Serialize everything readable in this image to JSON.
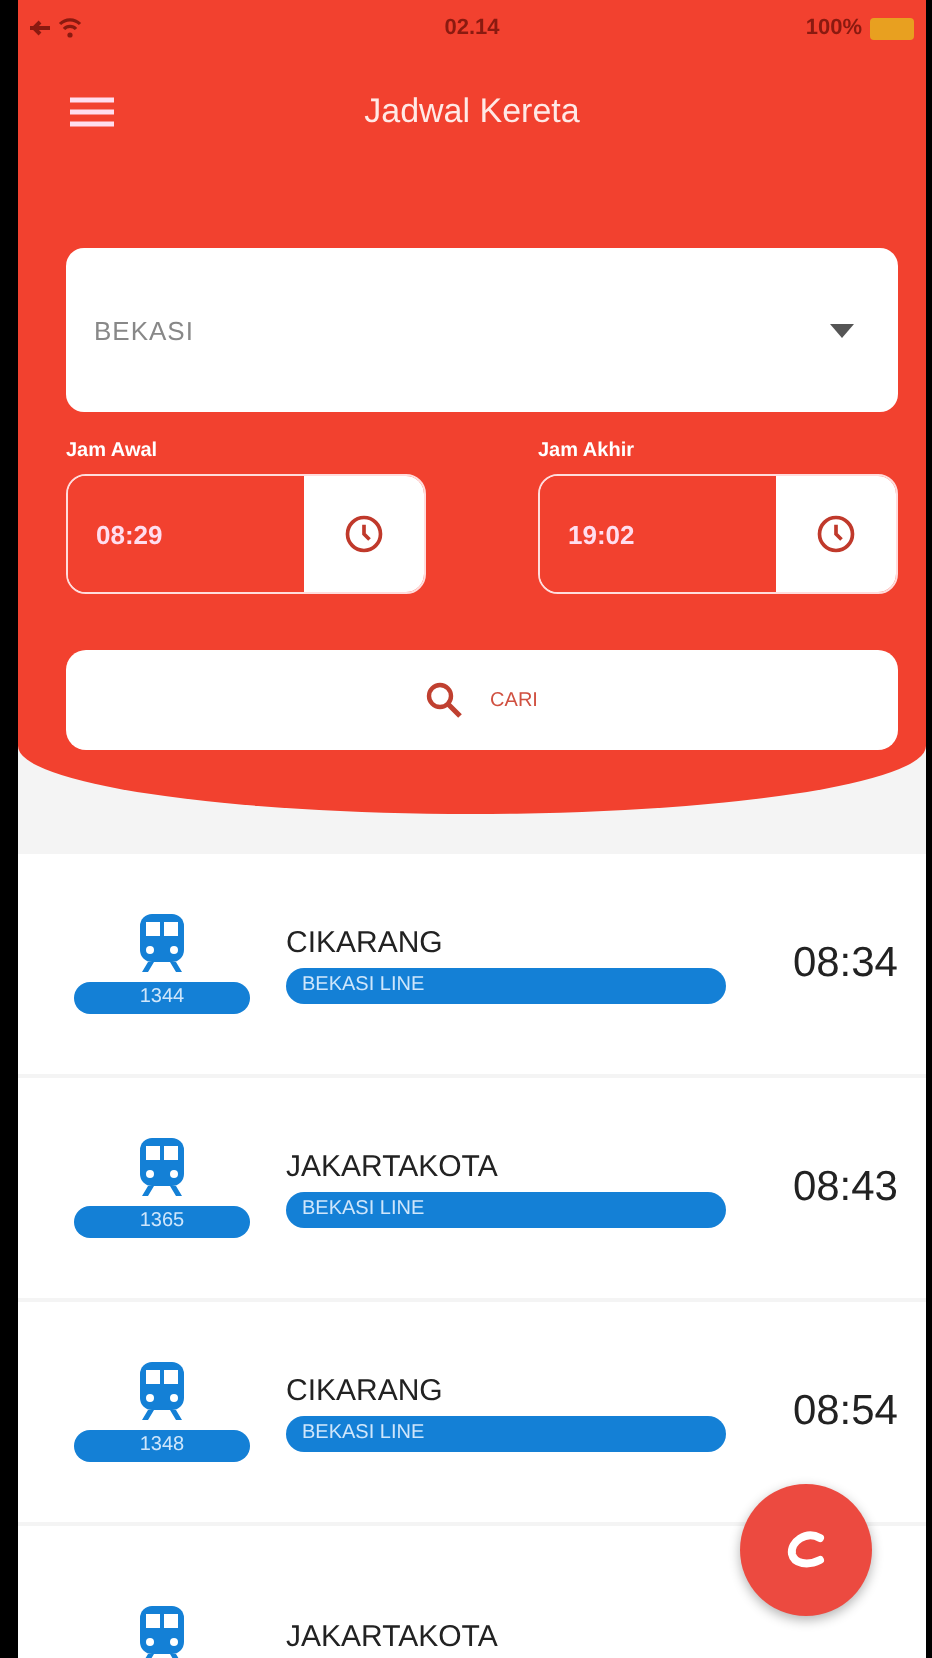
{
  "status_bar": {
    "time": "02.14",
    "battery": "100%"
  },
  "app_bar": {
    "title": "Jadwal Kereta"
  },
  "station": {
    "value": "BEKASI"
  },
  "time_start": {
    "label": "Jam Awal",
    "value": "08:29"
  },
  "time_end": {
    "label": "Jam Akhir",
    "value": "19:02"
  },
  "search_button": {
    "label": "CARI"
  },
  "schedules": [
    {
      "train_number": "1344",
      "destination": "CIKARANG",
      "line": "BEKASI LINE",
      "time": "08:34"
    },
    {
      "train_number": "1365",
      "destination": "JAKARTAKOTA",
      "line": "BEKASI LINE",
      "time": "08:43"
    },
    {
      "train_number": "1348",
      "destination": "CIKARANG",
      "line": "BEKASI LINE",
      "time": "08:54"
    },
    {
      "destination": "JAKARTAKOTA"
    }
  ]
}
